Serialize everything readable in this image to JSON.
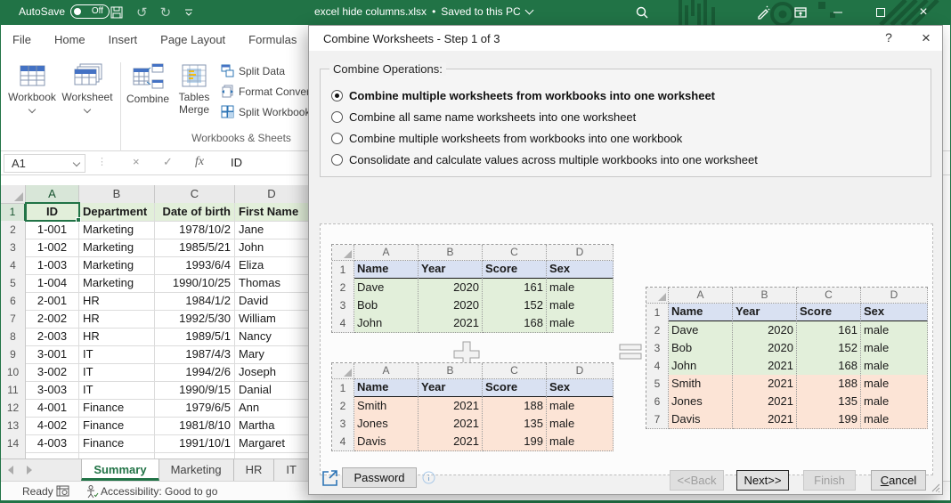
{
  "colors": {
    "excel_green": "#217346",
    "selected_header_fill": "#D8E6D8",
    "sheet_header_row_fill": "#E2EFDA",
    "mini_table_header_fill": "#D9E1F2",
    "green_row_fill": "#E2EFDA",
    "peach_row_fill": "#FCE4D6",
    "dialog_bg": "#F1F1F1",
    "button_bg": "#E1E1E1"
  },
  "titlebar": {
    "autosave_label": "AutoSave",
    "autosave_state": "Off",
    "document_title": "excel hide columns.xlsx",
    "separator": "•",
    "saved_status": "Saved to this PC"
  },
  "ribbon": {
    "tabs": [
      "File",
      "Home",
      "Insert",
      "Page Layout",
      "Formulas"
    ],
    "workbook_label": "Workbook",
    "worksheet_label": "Worksheet",
    "combine_label": "Combine",
    "tables_merge_line1": "Tables",
    "tables_merge_line2": "Merge",
    "split_data_label": "Split Data",
    "format_convert_label": "Format Convert",
    "split_workbook_label": "Split Workbook",
    "group_label": "Workbooks & Sheets"
  },
  "formula_bar": {
    "name_box": "A1",
    "fx_label": "fx",
    "cancel_glyph": "×",
    "enter_glyph": "✓",
    "content": "ID"
  },
  "sheet": {
    "columns": [
      "A",
      "B",
      "C",
      "D"
    ],
    "header_row": {
      "num": "1",
      "cells": [
        "ID",
        "Department",
        "Date of birth",
        "First Name"
      ]
    },
    "rows": [
      {
        "num": "2",
        "cells": [
          "1-001",
          "Marketing",
          "1978/10/2",
          "Jane"
        ]
      },
      {
        "num": "3",
        "cells": [
          "1-002",
          "Marketing",
          "1985/5/21",
          "John"
        ]
      },
      {
        "num": "4",
        "cells": [
          "1-003",
          "Marketing",
          "1993/6/4",
          "Eliza"
        ]
      },
      {
        "num": "5",
        "cells": [
          "1-004",
          "Marketing",
          "1990/10/25",
          "Thomas"
        ]
      },
      {
        "num": "6",
        "cells": [
          "2-001",
          "HR",
          "1984/1/2",
          "David"
        ]
      },
      {
        "num": "7",
        "cells": [
          "2-002",
          "HR",
          "1992/5/30",
          "William"
        ]
      },
      {
        "num": "8",
        "cells": [
          "2-003",
          "HR",
          "1989/5/1",
          "Nancy"
        ]
      },
      {
        "num": "9",
        "cells": [
          "3-001",
          "IT",
          "1987/4/3",
          "Mary"
        ]
      },
      {
        "num": "10",
        "cells": [
          "3-002",
          "IT",
          "1994/2/6",
          "Joseph"
        ]
      },
      {
        "num": "11",
        "cells": [
          "3-003",
          "IT",
          "1990/9/15",
          "Danial"
        ]
      },
      {
        "num": "12",
        "cells": [
          "4-001",
          "Finance",
          "1979/6/5",
          "Ann"
        ]
      },
      {
        "num": "13",
        "cells": [
          "4-002",
          "Finance",
          "1981/8/10",
          "Martha"
        ]
      },
      {
        "num": "14",
        "cells": [
          "4-003",
          "Finance",
          "1991/10/1",
          "Margaret"
        ]
      }
    ]
  },
  "sheet_tabs": [
    {
      "label": "Summary",
      "active": true
    },
    {
      "label": "Marketing",
      "active": false
    },
    {
      "label": "HR",
      "active": false
    },
    {
      "label": "IT",
      "active": false
    }
  ],
  "status_bar": {
    "ready": "Ready",
    "accessibility": "Accessibility: Good to go"
  },
  "dialog": {
    "title": "Combine Worksheets - Step 1 of 3",
    "help_label": "?",
    "close_glyph": "×",
    "combine_operations_label": "Combine Operations:",
    "options": [
      {
        "label": "Combine multiple worksheets from workbooks into one worksheet",
        "selected": true
      },
      {
        "label": "Combine all same name worksheets into one worksheet",
        "selected": false
      },
      {
        "label": "Combine multiple worksheets from workbooks into one workbook",
        "selected": false
      },
      {
        "label": "Consolidate and calculate values across multiple workbooks into one worksheet",
        "selected": false
      }
    ],
    "preview": {
      "columns": [
        "A",
        "B",
        "C",
        "D"
      ],
      "header_num": "1",
      "header": [
        "Name",
        "Year",
        "Score",
        "Sex"
      ],
      "table1": {
        "rows": [
          {
            "num": "2",
            "cells": [
              "Dave",
              "2020",
              "161",
              "male"
            ]
          },
          {
            "num": "3",
            "cells": [
              "Bob",
              "2020",
              "152",
              "male"
            ]
          },
          {
            "num": "4",
            "cells": [
              "John",
              "2021",
              "168",
              "male"
            ]
          }
        ]
      },
      "table2": {
        "rows": [
          {
            "num": "2",
            "cells": [
              "Smith",
              "2021",
              "188",
              "male"
            ]
          },
          {
            "num": "3",
            "cells": [
              "Jones",
              "2021",
              "135",
              "male"
            ]
          },
          {
            "num": "4",
            "cells": [
              "Davis",
              "2021",
              "199",
              "male"
            ]
          }
        ]
      },
      "result": {
        "rows": [
          {
            "num": "2",
            "cells": [
              "Dave",
              "2020",
              "161",
              "male"
            ]
          },
          {
            "num": "3",
            "cells": [
              "Bob",
              "2020",
              "152",
              "male"
            ]
          },
          {
            "num": "4",
            "cells": [
              "John",
              "2021",
              "168",
              "male"
            ]
          },
          {
            "num": "5",
            "cells": [
              "Smith",
              "2021",
              "188",
              "male"
            ]
          },
          {
            "num": "6",
            "cells": [
              "Jones",
              "2021",
              "135",
              "male"
            ]
          },
          {
            "num": "7",
            "cells": [
              "Davis",
              "2021",
              "199",
              "male"
            ]
          }
        ]
      }
    },
    "password_label": "Password",
    "buttons": {
      "back": "<<Back",
      "next": "Next>>",
      "finish": "Finish",
      "cancel": "Cancel"
    }
  }
}
